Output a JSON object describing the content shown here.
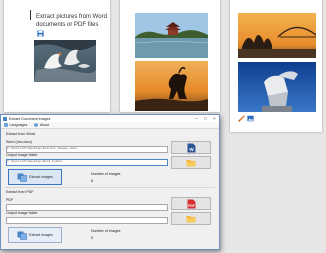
{
  "document": {
    "heading": "Extract pictures from Word documents or PDF files"
  },
  "dialog": {
    "title": "Extract Document Images",
    "menu": [
      {
        "label": "Languages"
      },
      {
        "label": "About"
      }
    ],
    "word_section": {
      "heading": "Extract from Word",
      "file_label": "Word (doc,docx)",
      "file_value": "C:\\Users\\PC\\Desktop\\Extract_Images.docx",
      "folder_label": "Output image folder",
      "folder_value": "C:\\Users\\PC\\Desktop\\Word_Folder",
      "extract_label": "Extract images",
      "count_label": "Number of images",
      "count_value": "6"
    },
    "pdf_section": {
      "heading": "Extract from PDF",
      "file_label": "PDF",
      "file_value": "",
      "folder_label": "Output image folder",
      "folder_value": "",
      "extract_label": "Extract images",
      "count_label": "Number of images",
      "count_value": "0"
    }
  },
  "colors": {
    "dialog_border": "#6d8fc1",
    "word_icon": "#2b5797",
    "pdf_icon": "#d32f2f",
    "folder_icon": "#f2b632"
  },
  "icons": [
    "save-icon",
    "crop-icon",
    "image-icon",
    "word-file-icon",
    "pdf-file-icon",
    "folder-icon",
    "extract-images-icon",
    "minimize-icon",
    "maximize-icon",
    "close-icon"
  ]
}
